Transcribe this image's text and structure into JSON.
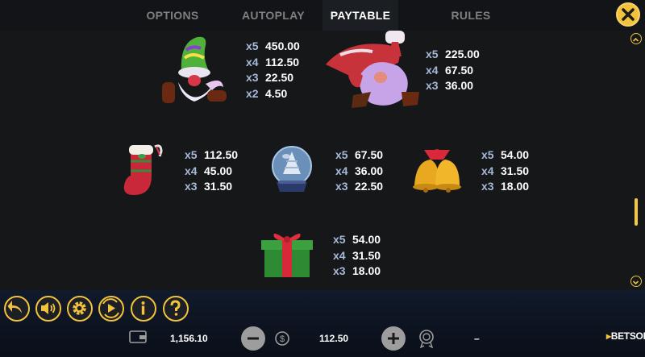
{
  "tabs": [
    {
      "label": "OPTIONS",
      "active": false
    },
    {
      "label": "AUTOPLAY",
      "active": false
    },
    {
      "label": "PAYTABLE",
      "active": true
    },
    {
      "label": "RULES",
      "active": false
    }
  ],
  "close_icon": "close-icon",
  "paytable": {
    "gnome_green": [
      [
        "x5",
        "450.00"
      ],
      [
        "x4",
        "112.50"
      ],
      [
        "x3",
        "22.50"
      ],
      [
        "x2",
        "4.50"
      ]
    ],
    "gnome_red": [
      [
        "x5",
        "225.00"
      ],
      [
        "x4",
        "67.50"
      ],
      [
        "x3",
        "36.00"
      ]
    ],
    "stocking": [
      [
        "x5",
        "112.50"
      ],
      [
        "x4",
        "45.00"
      ],
      [
        "x3",
        "31.50"
      ]
    ],
    "snow_globe": [
      [
        "x5",
        "67.50"
      ],
      [
        "x4",
        "36.00"
      ],
      [
        "x3",
        "22.50"
      ]
    ],
    "bells": [
      [
        "x5",
        "54.00"
      ],
      [
        "x4",
        "31.50"
      ],
      [
        "x3",
        "18.00"
      ]
    ],
    "gift": [
      [
        "x5",
        "54.00"
      ],
      [
        "x4",
        "31.50"
      ],
      [
        "x3",
        "18.00"
      ]
    ]
  },
  "controls": {
    "back_icon": "back-arrow-icon",
    "sound_icon": "speaker-icon",
    "settings_icon": "gear-icon",
    "autoplay_icon": "autoplay-icon",
    "info_icon": "info-icon",
    "help_icon": "question-icon"
  },
  "footer": {
    "balance": "1,156.10",
    "bet": "112.50",
    "win": "–",
    "brand": "BETSOFT"
  },
  "colors": {
    "accent": "#f2c23a",
    "tab_active_bg": "#1b1e22",
    "multiplier": "#a7b9d8",
    "amount": "#ffffff"
  }
}
